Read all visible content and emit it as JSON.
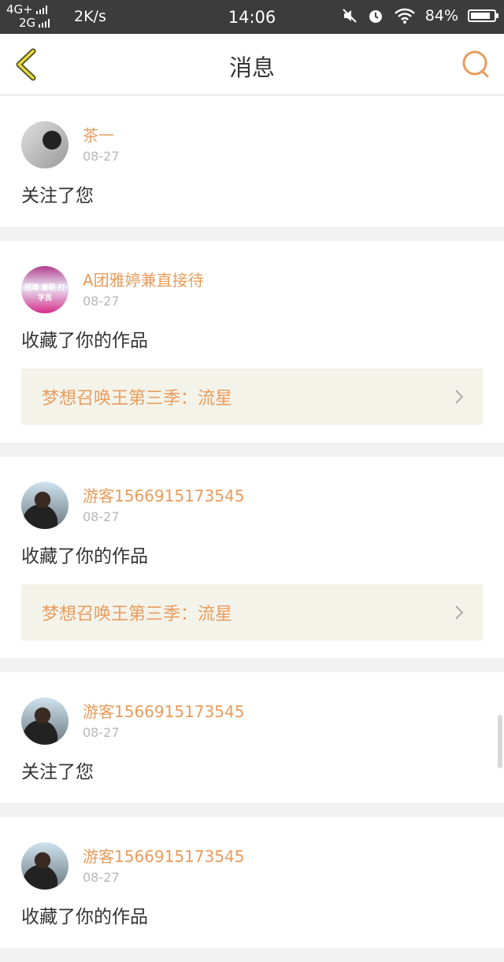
{
  "status": {
    "net_top": "4G+",
    "net_bottom": "2G",
    "speed": "2K/s",
    "time": "14:06",
    "battery": "84%",
    "battery_level": 0.84
  },
  "header": {
    "title": "消息",
    "back_icon": "chevron-left-icon",
    "search_icon": "search-icon",
    "accent_color": "#e89c5c"
  },
  "messages": [
    {
      "user": "茶一",
      "date": "08-27",
      "action": "关注了您",
      "work": ""
    },
    {
      "user": "A团雅婷兼直接待",
      "date": "08-27",
      "action": "收藏了你的作品",
      "work": "梦想召唤王第三季：流星",
      "avatar_text": "招聘 兼职 打字员"
    },
    {
      "user": "游客1566915173545",
      "date": "08-27",
      "action": "收藏了你的作品",
      "work": "梦想召唤王第三季：流星"
    },
    {
      "user": "游客1566915173545",
      "date": "08-27",
      "action": "关注了您",
      "work": ""
    },
    {
      "user": "游客1566915173545",
      "date": "08-27",
      "action": "收藏了你的作品",
      "work": ""
    }
  ]
}
